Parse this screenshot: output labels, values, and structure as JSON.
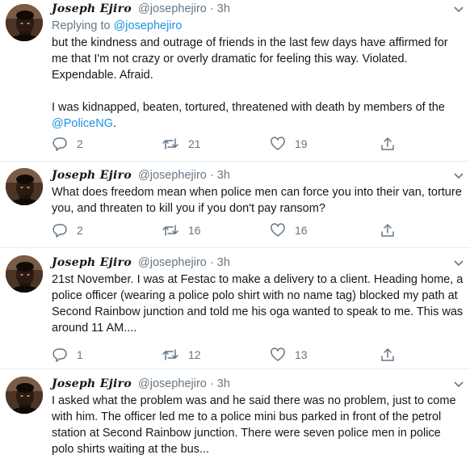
{
  "tweets": [
    {
      "name": "Joseph Ejiro",
      "handle": "@josephejiro",
      "dot": "·",
      "time": "3h",
      "reply_prefix": "Replying to ",
      "reply_handle": "@josephejiro",
      "text_lines": [
        "but the kindness and outrage of friends in the last few days have affirmed for me that I'm not crazy or overly dramatic for feeling this way. Violated. Expendable. Afraid."
      ],
      "text2": "I was kidnapped, beaten, tortured, threatened with death by members of the ",
      "text2_link": "@PoliceNG",
      "text2_end": ".",
      "replies": "2",
      "retweets": "21",
      "likes": "19"
    },
    {
      "name": "Joseph Ejiro",
      "handle": "@josephejiro",
      "dot": "·",
      "time": "3h",
      "text": "What does freedom mean when police men can force you into their van, torture you, and threaten to kill you if you don't pay ransom?",
      "replies": "2",
      "retweets": "16",
      "likes": "16"
    },
    {
      "name": "Joseph Ejiro",
      "handle": "@josephejiro",
      "dot": "·",
      "time": "3h",
      "text": "21st November. I was at Festac to make a delivery to a client. Heading home, a police officer (wearing a police polo shirt with no name tag) blocked my path at Second Rainbow junction and told me his oga wanted to speak to me. This was around 11 AM....",
      "replies": "1",
      "retweets": "12",
      "likes": "13"
    },
    {
      "name": "Joseph Ejiro",
      "handle": "@josephejiro",
      "dot": "·",
      "time": "3h",
      "text": "I asked what the problem was and he said there was no problem, just to come with him. The officer led me to a police mini bus parked in front of the petrol station at Second Rainbow junction. There were seven police men in police polo shirts waiting at the bus..."
    }
  ],
  "icons": {
    "reply": "comment-icon",
    "retweet": "retweet-icon",
    "like": "heart-icon",
    "share": "share-icon",
    "more": "chevron-down-icon"
  },
  "colors": {
    "link": "#1b95e0",
    "secondary_text": "#657786",
    "primary_text": "#14171a",
    "divider": "#e6ecf0"
  }
}
